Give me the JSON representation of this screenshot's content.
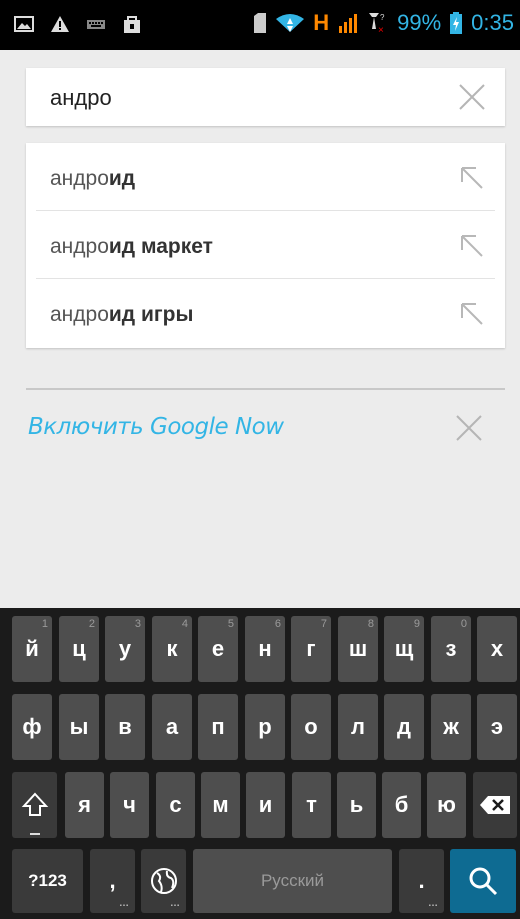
{
  "status_bar": {
    "battery_percent": "99%",
    "time": "0:35",
    "network_type": "H",
    "icons": [
      "image-icon",
      "warning-icon",
      "keyboard-icon",
      "shop-icon",
      "sd-card-icon",
      "wifi-icon",
      "signal-icon",
      "missed-signal-icon",
      "battery-charging-icon"
    ]
  },
  "search": {
    "query": "андро"
  },
  "suggestions": [
    {
      "prefix": "андро",
      "rest": "ид"
    },
    {
      "prefix": "андро",
      "rest": "ид маркет"
    },
    {
      "prefix": "андро",
      "rest": "ид игры"
    }
  ],
  "google_now": {
    "label": "Включить Google Now"
  },
  "keyboard": {
    "row1": [
      {
        "label": "й",
        "hint": "1"
      },
      {
        "label": "ц",
        "hint": "2"
      },
      {
        "label": "у",
        "hint": "3"
      },
      {
        "label": "к",
        "hint": "4"
      },
      {
        "label": "е",
        "hint": "5"
      },
      {
        "label": "н",
        "hint": "6"
      },
      {
        "label": "г",
        "hint": "7"
      },
      {
        "label": "ш",
        "hint": "8"
      },
      {
        "label": "щ",
        "hint": "9"
      },
      {
        "label": "з",
        "hint": "0"
      },
      {
        "label": "х",
        "hint": ""
      }
    ],
    "row2": [
      "ф",
      "ы",
      "в",
      "а",
      "п",
      "р",
      "о",
      "л",
      "д",
      "ж",
      "э"
    ],
    "row3": [
      "я",
      "ч",
      "с",
      "м",
      "и",
      "т",
      "ь",
      "б",
      "ю"
    ],
    "symbols_label": "?123",
    "comma_label": ",",
    "space_label": "Русский",
    "period_label": ".",
    "accent_color": "#33b5e5",
    "search_key_color": "#0e6b92"
  }
}
